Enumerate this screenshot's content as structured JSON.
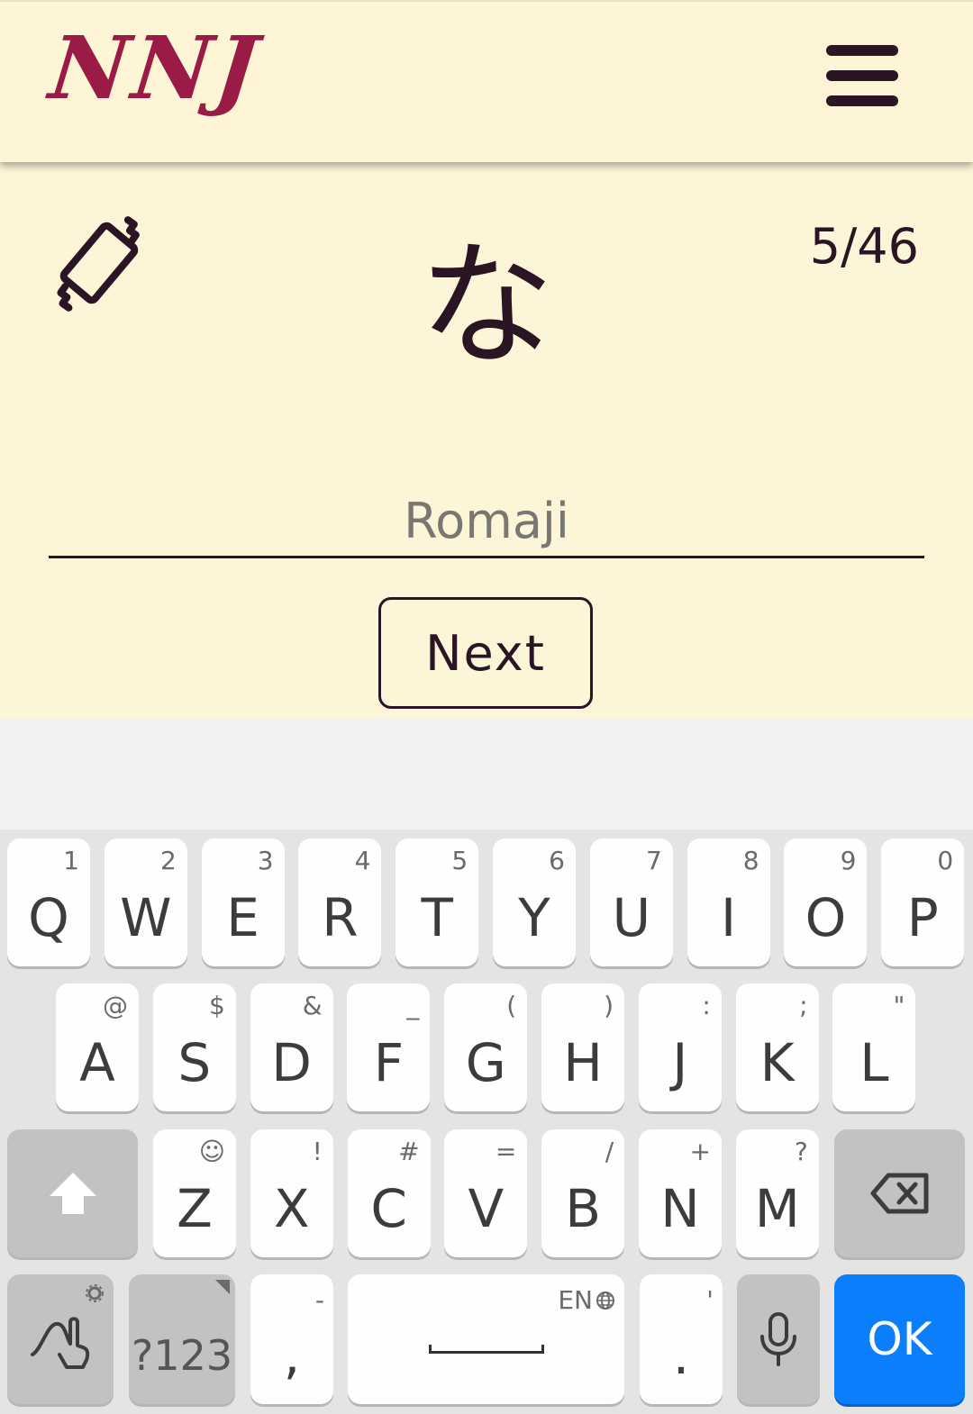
{
  "app": {
    "logo": "NNJ",
    "counter": "5/46",
    "kana": "な",
    "romaji_placeholder": "Romaji",
    "romaji_value": "",
    "next_label": "Next"
  },
  "keyboard": {
    "row1": [
      {
        "k": "Q",
        "h": "1"
      },
      {
        "k": "W",
        "h": "2"
      },
      {
        "k": "E",
        "h": "3"
      },
      {
        "k": "R",
        "h": "4"
      },
      {
        "k": "T",
        "h": "5"
      },
      {
        "k": "Y",
        "h": "6"
      },
      {
        "k": "U",
        "h": "7"
      },
      {
        "k": "I",
        "h": "8"
      },
      {
        "k": "O",
        "h": "9"
      },
      {
        "k": "P",
        "h": "0"
      }
    ],
    "row2": [
      {
        "k": "A",
        "h": "@"
      },
      {
        "k": "S",
        "h": "$"
      },
      {
        "k": "D",
        "h": "&"
      },
      {
        "k": "F",
        "h": "_"
      },
      {
        "k": "G",
        "h": "("
      },
      {
        "k": "H",
        "h": ")"
      },
      {
        "k": "J",
        "h": ":"
      },
      {
        "k": "K",
        "h": ";"
      },
      {
        "k": "L",
        "h": "\""
      }
    ],
    "row3": [
      {
        "k": "Z",
        "h": "☺"
      },
      {
        "k": "X",
        "h": "!"
      },
      {
        "k": "C",
        "h": "#"
      },
      {
        "k": "V",
        "h": "="
      },
      {
        "k": "B",
        "h": "/"
      },
      {
        "k": "N",
        "h": "+"
      },
      {
        "k": "M",
        "h": "?"
      }
    ],
    "symbols_label": "?123",
    "comma": ",",
    "comma_hint": "-",
    "space_lang": "EN",
    "period": ".",
    "period_hint": "'",
    "ok_label": "OK",
    "icons": [
      "shift-icon",
      "backspace-icon",
      "gesture-icon",
      "settings-gear-icon",
      "globe-icon",
      "microphone-icon",
      "menu-icon",
      "rotate-device-icon"
    ]
  }
}
